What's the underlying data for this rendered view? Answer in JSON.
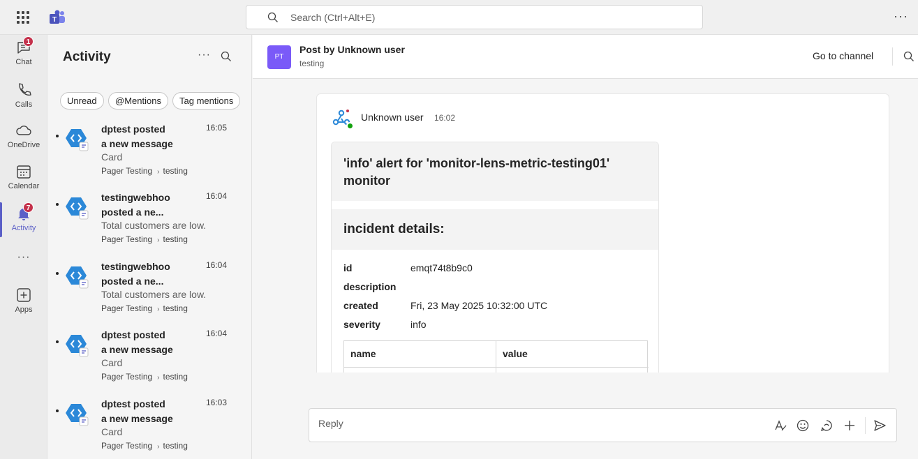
{
  "topbar": {
    "search_placeholder": "Search (Ctrl+Alt+E)",
    "waffle_icon": "app-launcher-icon",
    "logo_icon": "teams-logo-icon",
    "more_label": "···"
  },
  "rail": {
    "items": [
      {
        "label": "Chat",
        "icon": "chat-icon",
        "badge": "1"
      },
      {
        "label": "Calls",
        "icon": "phone-icon"
      },
      {
        "label": "OneDrive",
        "icon": "cloud-icon"
      },
      {
        "label": "Calendar",
        "icon": "calendar-icon"
      },
      {
        "label": "Activity",
        "icon": "bell-icon",
        "badge": "7",
        "active": true
      },
      {
        "label": "Apps",
        "icon": "add-app-icon"
      }
    ],
    "more_label": "···",
    "accent": "#5b5fc7",
    "badge_color": "#c4314b"
  },
  "activity": {
    "title": "Activity",
    "filters": [
      "Unread",
      "@Mentions",
      "Tag mentions"
    ],
    "items": [
      {
        "line1": "dptest posted",
        "line2": "a new message",
        "time": "16:05",
        "preview": "Card",
        "team": "Pager Testing",
        "channel": "testing"
      },
      {
        "line1": "testingwebhoo",
        "line2": "posted a ne...",
        "time": "16:04",
        "preview": "Total customers are low.",
        "team": "Pager Testing",
        "channel": "testing"
      },
      {
        "line1": "testingwebhoo",
        "line2": "posted a ne...",
        "time": "16:04",
        "preview": "Total customers are low.",
        "team": "Pager Testing",
        "channel": "testing"
      },
      {
        "line1": "dptest posted",
        "line2": "a new message",
        "time": "16:04",
        "preview": "Card",
        "team": "Pager Testing",
        "channel": "testing"
      },
      {
        "line1": "dptest posted",
        "line2": "a new message",
        "time": "16:03",
        "preview": "Card",
        "team": "Pager Testing",
        "channel": "testing"
      }
    ]
  },
  "main": {
    "header": {
      "avatar_initials": "PT",
      "title": "Post by Unknown user",
      "subtitle": "testing",
      "go_to_channel": "Go to channel"
    },
    "post": {
      "author": "Unknown user",
      "time": "16:02",
      "card": {
        "title": "'info' alert for 'monitor-lens-metric-testing01' monitor",
        "section_title": "incident details:",
        "facts": [
          {
            "key": "id",
            "value": "emqt74t8b9c0"
          },
          {
            "key": "description",
            "value": ""
          },
          {
            "key": "created",
            "value": "Fri, 23 May 2025 10:32:00 UTC"
          },
          {
            "key": "severity",
            "value": "info"
          }
        ],
        "table_headers": [
          "name",
          "value"
        ]
      }
    },
    "reply": {
      "placeholder": "Reply",
      "actions": [
        "format-icon",
        "emoji-icon",
        "loop-icon",
        "add-icon",
        "send-icon"
      ]
    }
  }
}
